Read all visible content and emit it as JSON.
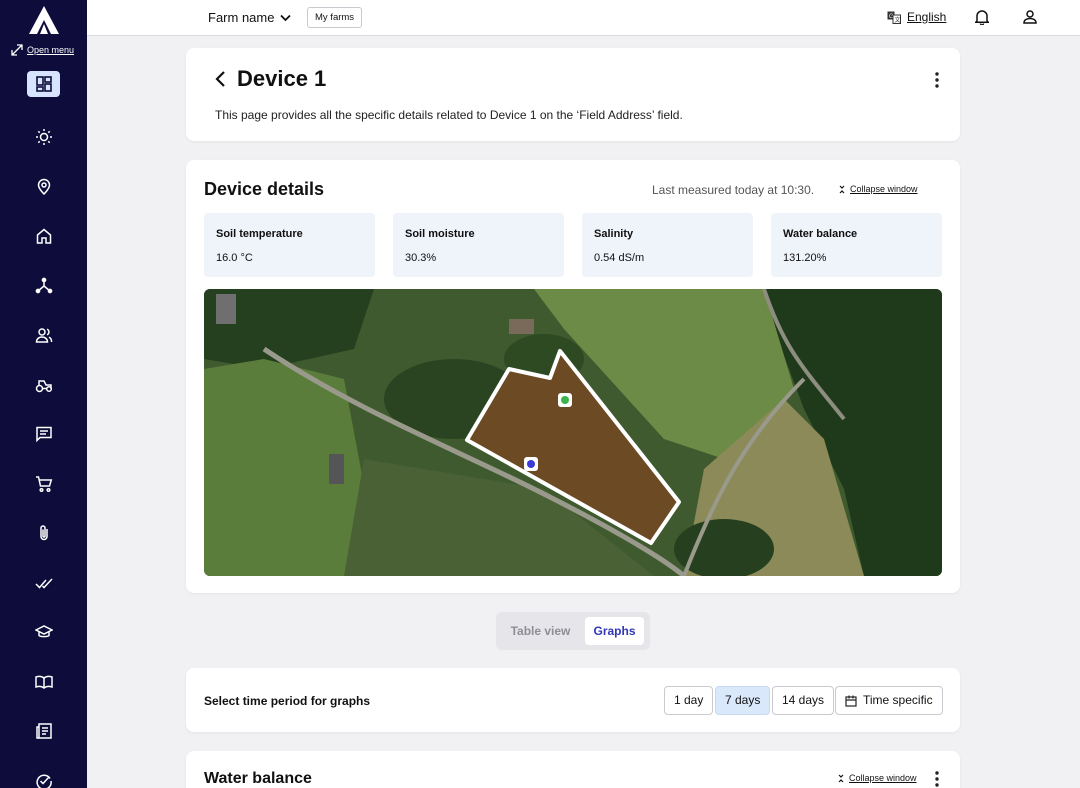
{
  "sidebar": {
    "open_menu_label": "Open menu",
    "items": [
      {
        "name": "dashboard-icon",
        "active": true
      },
      {
        "name": "weather-sun-icon"
      },
      {
        "name": "location-pin-icon"
      },
      {
        "name": "home-icon"
      },
      {
        "name": "network-icon"
      },
      {
        "name": "users-icon"
      },
      {
        "name": "tractor-icon"
      },
      {
        "name": "chat-icon"
      },
      {
        "name": "cart-icon"
      },
      {
        "name": "attachment-icon"
      },
      {
        "name": "double-check-icon"
      },
      {
        "name": "graduation-cap-icon"
      },
      {
        "name": "book-icon"
      },
      {
        "name": "news-icon"
      },
      {
        "name": "add-task-icon"
      }
    ]
  },
  "topbar": {
    "farm_name": "Farm name",
    "my_farms": "My farms",
    "language": "English"
  },
  "header": {
    "title": "Device 1",
    "description": "This page provides all the specific details related to Device 1 on the ‘Field Address’ field."
  },
  "details": {
    "title": "Device details",
    "last_measured": "Last measured today at 10:30.",
    "collapse_label": "Collapse window",
    "metrics": [
      {
        "label": "Soil temperature",
        "value": "16.0 °C"
      },
      {
        "label": "Soil moisture",
        "value": "30.3%"
      },
      {
        "label": "Salinity",
        "value": "0.54 dS/m"
      },
      {
        "label": "Water balance",
        "value": "131.20%"
      }
    ]
  },
  "view_toggle": {
    "options": [
      "Table view",
      "Graphs"
    ],
    "selected": "Graphs"
  },
  "period": {
    "label": "Select time period for graphs",
    "options": [
      "1 day",
      "7 days",
      "14 days",
      "Time specific"
    ],
    "selected": "7 days"
  },
  "water_balance": {
    "title": "Water balance",
    "collapse_label": "Collapse window"
  },
  "colors": {
    "sidebar_bg": "#0d0c3b",
    "accent": "#3137b6",
    "selected_bg": "#d9e8fb",
    "field_fill": "#6b4a24",
    "device_green": "#3bb54a",
    "device_blue": "#3a3ad9"
  }
}
